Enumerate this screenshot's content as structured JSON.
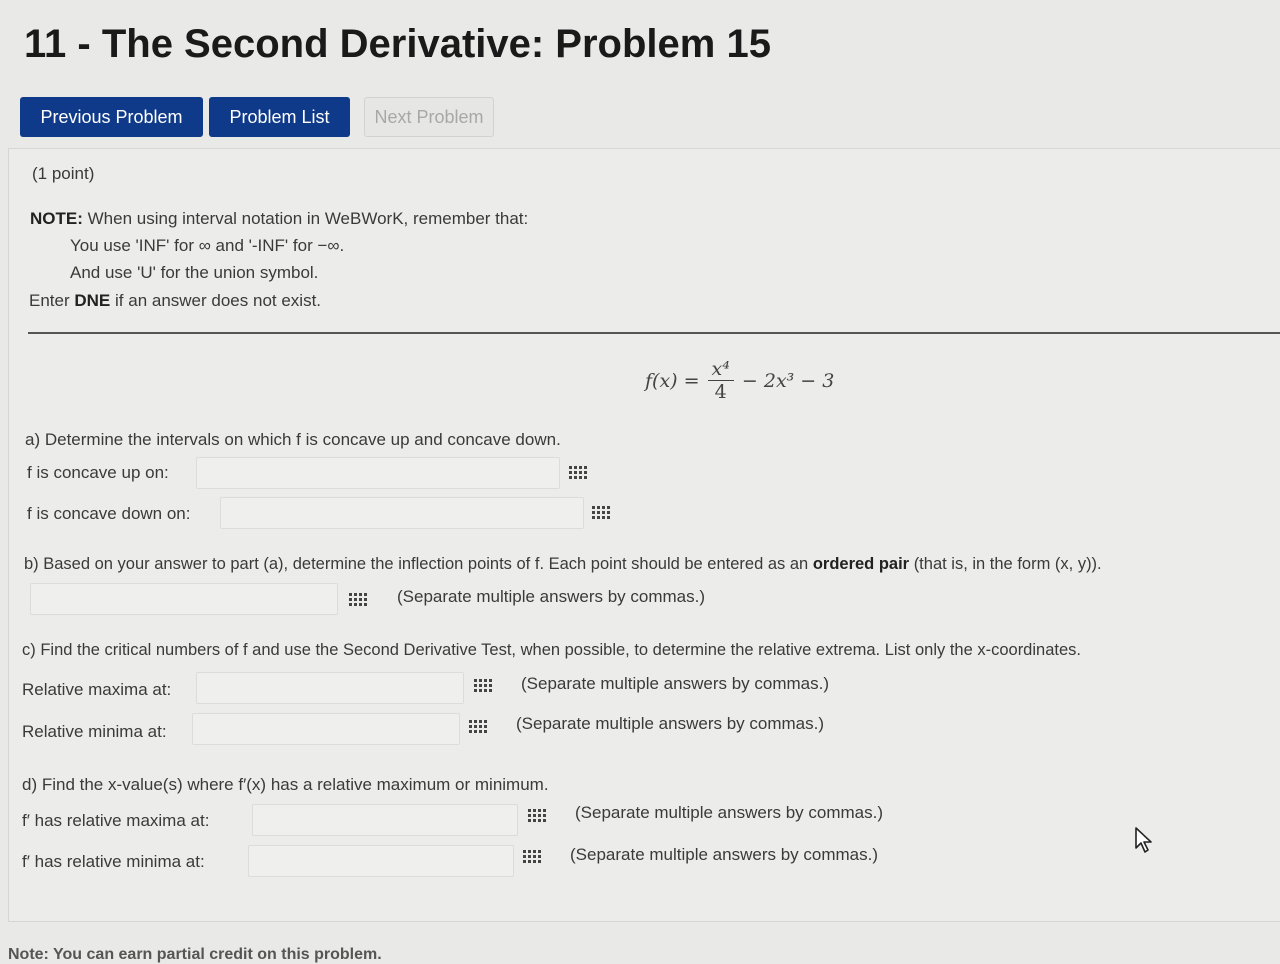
{
  "page": {
    "title": "11 - The Second Derivative: Problem 15"
  },
  "nav": {
    "previous": "Previous Problem",
    "list": "Problem List",
    "next": "Next Problem"
  },
  "problem": {
    "points": "(1 point)",
    "note_label": "NOTE:",
    "note_text": "When using interval notation in WeBWorK, remember that:",
    "note_line1": "You use 'INF' for ∞ and '-INF' for −∞.",
    "note_line2": "And use 'U' for the union symbol.",
    "dne_prefix": "Enter",
    "dne_word": "DNE",
    "dne_suffix": "if an answer does not exist.",
    "formula": {
      "lhs": "f(x) =",
      "num": "x⁴",
      "den": "4",
      "rest": "− 2x³ − 3"
    },
    "part_a": {
      "prompt": "a) Determine the intervals on which f is concave up and concave down.",
      "up_label": "f is concave up on:",
      "down_label": "f is concave down on:"
    },
    "part_b": {
      "prompt_pre": "b) Based on your answer to part (a), determine the inflection points of f. Each point should be entered as an",
      "prompt_bold": "ordered pair",
      "prompt_post": "(that is, in the form (x, y)).",
      "hint": "(Separate multiple answers by commas.)"
    },
    "part_c": {
      "prompt": "c) Find the critical numbers of f and use the Second Derivative Test, when possible, to determine the relative extrema. List only the x-coordinates.",
      "max_label": "Relative maxima at:",
      "min_label": "Relative minima at:",
      "hint": "(Separate multiple answers by commas.)"
    },
    "part_d": {
      "prompt": "d) Find the x-value(s) where f′(x) has a relative maximum or minimum.",
      "max_label": "f′ has relative maxima at:",
      "min_label": "f′ has relative minima at:",
      "hint": "(Separate multiple answers by commas.)"
    },
    "footnote": "Note: You can earn partial credit on this problem."
  },
  "icons": {
    "answer_tool": "grid-icon",
    "cursor": "mouse-pointer-icon"
  },
  "colors": {
    "primary_button": "#0f3a8a",
    "background": "#e9e9e7"
  }
}
